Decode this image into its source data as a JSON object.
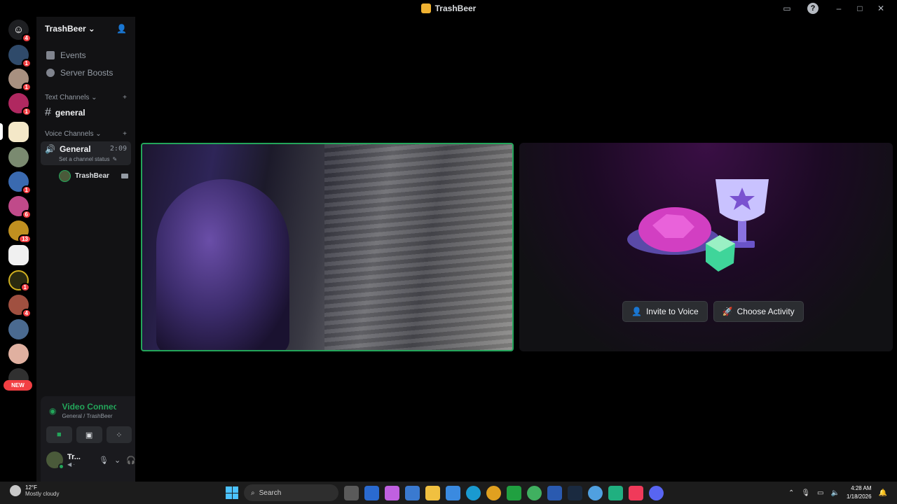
{
  "window": {
    "title": "TrashBeer"
  },
  "rail": {
    "home_badge": "4",
    "badges": [
      "1",
      "1",
      "1",
      "1",
      "6",
      "13",
      "1",
      "4"
    ],
    "new_label": "NEW"
  },
  "sidebar": {
    "server_name": "TrashBeer",
    "menu": [
      {
        "label": "Events",
        "icon": "calendar-icon"
      },
      {
        "label": "Server Boosts",
        "icon": "boost-icon"
      }
    ],
    "text_category": "Text Channels",
    "text_channel": "general",
    "voice_category": "Voice Channels",
    "voice_channel": {
      "name": "General",
      "timer": "2:09",
      "status": "Set a channel status"
    },
    "voice_user": "TrashBear"
  },
  "voice_panel": {
    "status": "Video Connected",
    "location": "General / TrashBeer",
    "user_short": "Tr..."
  },
  "stage": {
    "invite_label": "Invite to Voice",
    "activity_label": "Choose Activity"
  },
  "taskbar": {
    "temp": "12°F",
    "condition": "Mostly cloudy",
    "search_label": "Search",
    "time": "4:28 AM",
    "date": "1/18/2026"
  },
  "colors": {
    "accent_green": "#23a55a",
    "notification_red": "#f23f43",
    "sidebar_bg": "#121214"
  }
}
